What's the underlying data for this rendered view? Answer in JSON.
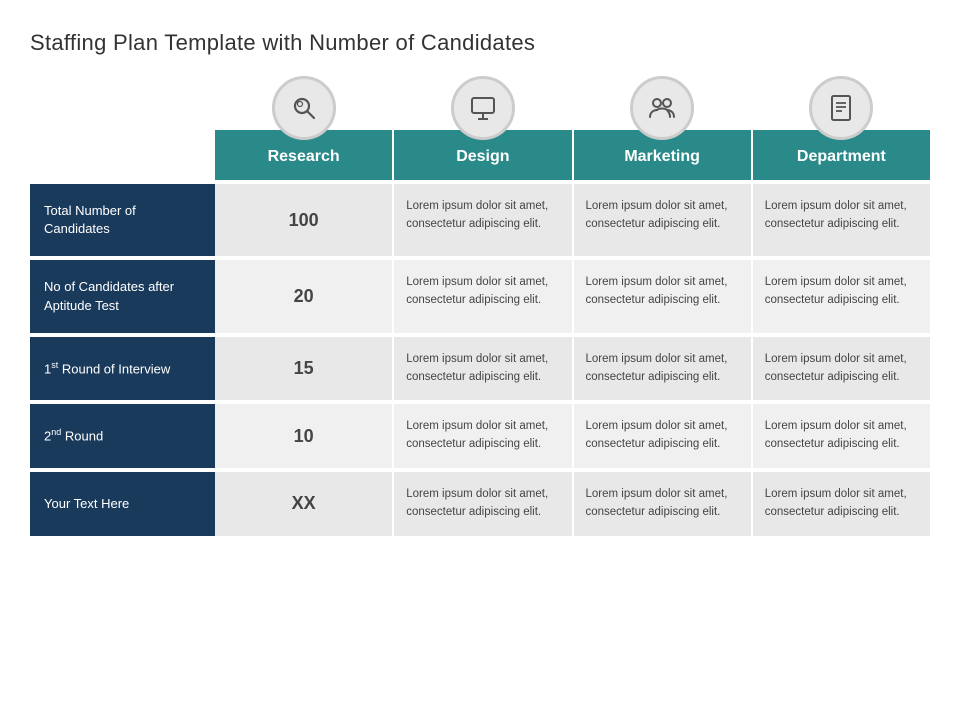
{
  "title": "Staffing Plan Template with Number of Candidates",
  "icons": [
    {
      "name": "search-icon",
      "symbol": "🔍"
    },
    {
      "name": "monitor-icon",
      "symbol": "🖥"
    },
    {
      "name": "people-icon",
      "symbol": "👥"
    },
    {
      "name": "document-icon",
      "symbol": "📄"
    }
  ],
  "headers": {
    "col1": "Research",
    "col2": "Design",
    "col3": "Marketing",
    "col4": "Department"
  },
  "rows": [
    {
      "label": "Total Number of Candidates",
      "superscript": "",
      "label_suffix": "",
      "number": "100",
      "col2": "Lorem ipsum dolor sit amet, consectetur adipiscing elit.",
      "col3": "Lorem ipsum dolor sit amet, consectetur adipiscing elit.",
      "col4": "Lorem ipsum dolor sit amet, consectetur adipiscing elit."
    },
    {
      "label": "No of Candidates after Aptitude Test",
      "superscript": "",
      "label_suffix": "",
      "number": "20",
      "col2": "Lorem ipsum dolor sit amet, consectetur adipiscing elit.",
      "col3": "Lorem ipsum dolor sit amet, consectetur adipiscing elit.",
      "col4": "Lorem ipsum dolor sit amet, consectetur adipiscing elit."
    },
    {
      "label": "1st Round of Interview",
      "superscript": "st",
      "label_prefix": "1",
      "label_main": " Round of Interview",
      "number": "15",
      "col2": "Lorem ipsum dolor sit amet, consectetur adipiscing elit.",
      "col3": "Lorem ipsum dolor sit amet, consectetur adipiscing elit.",
      "col4": "Lorem ipsum dolor sit amet, consectetur adipiscing elit."
    },
    {
      "label": "2nd Round",
      "superscript": "nd",
      "label_prefix": "2",
      "label_main": " Round",
      "number": "10",
      "col2": "Lorem ipsum dolor sit amet, consectetur adipiscing elit.",
      "col3": "Lorem ipsum dolor sit amet, consectetur adipiscing elit.",
      "col4": "Lorem ipsum dolor sit amet, consectetur adipiscing elit."
    },
    {
      "label": "Your Text Here",
      "superscript": "",
      "label_suffix": "",
      "number": "XX",
      "col2": "Lorem ipsum dolor sit amet, consectetur adipiscing elit.",
      "col3": "Lorem ipsum dolor sit amet, consectetur adipiscing elit.",
      "col4": "Lorem ipsum dolor sit amet, consectetur adipiscing elit."
    }
  ]
}
